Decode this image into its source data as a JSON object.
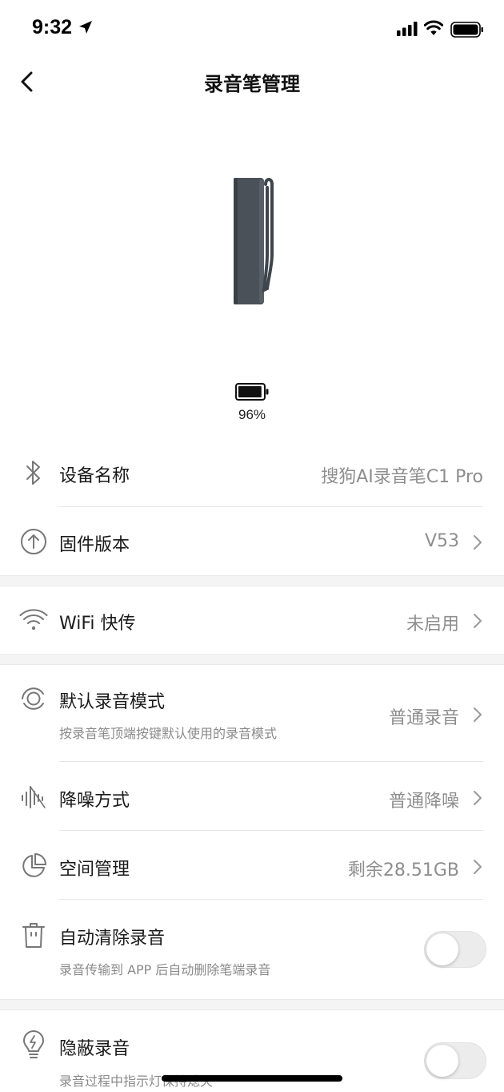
{
  "status_bar": {
    "time": "9:32"
  },
  "header": {
    "title": "录音笔管理"
  },
  "device": {
    "battery_percent": "96%",
    "battery_level": 0.96
  },
  "settings": {
    "device_name": {
      "label": "设备名称",
      "value": "搜狗AI录音笔C1 Pro",
      "icon": "bluetooth-icon"
    },
    "firmware": {
      "label": "固件版本",
      "value": "V53",
      "icon": "upload-circle-icon"
    },
    "wifi_transfer": {
      "label": "WiFi 快传",
      "value": "未启用",
      "icon": "wifi-icon"
    },
    "default_mode": {
      "label": "默认录音模式",
      "subtitle": "按录音笔顶端按键默认使用的录音模式",
      "value": "普通录音",
      "icon": "record-mode-icon"
    },
    "noise_reduction": {
      "label": "降噪方式",
      "value": "普通降噪",
      "icon": "waveform-icon"
    },
    "storage": {
      "label": "空间管理",
      "value": "剩余28.51GB",
      "icon": "pie-chart-icon"
    },
    "auto_clear": {
      "label": "自动清除录音",
      "subtitle": "录音传输到 APP 后自动删除笔端录音",
      "enabled": false,
      "icon": "trash-icon"
    },
    "hidden_record": {
      "label": "隐蔽录音",
      "subtitle": "录音过程中指示灯保持熄灭",
      "enabled": false,
      "icon": "lightbulb-icon"
    }
  },
  "colors": {
    "text": "#1a1a1a",
    "secondary": "#8e8e8e",
    "device": "#4a5058",
    "separator": "#f4f4f4"
  }
}
